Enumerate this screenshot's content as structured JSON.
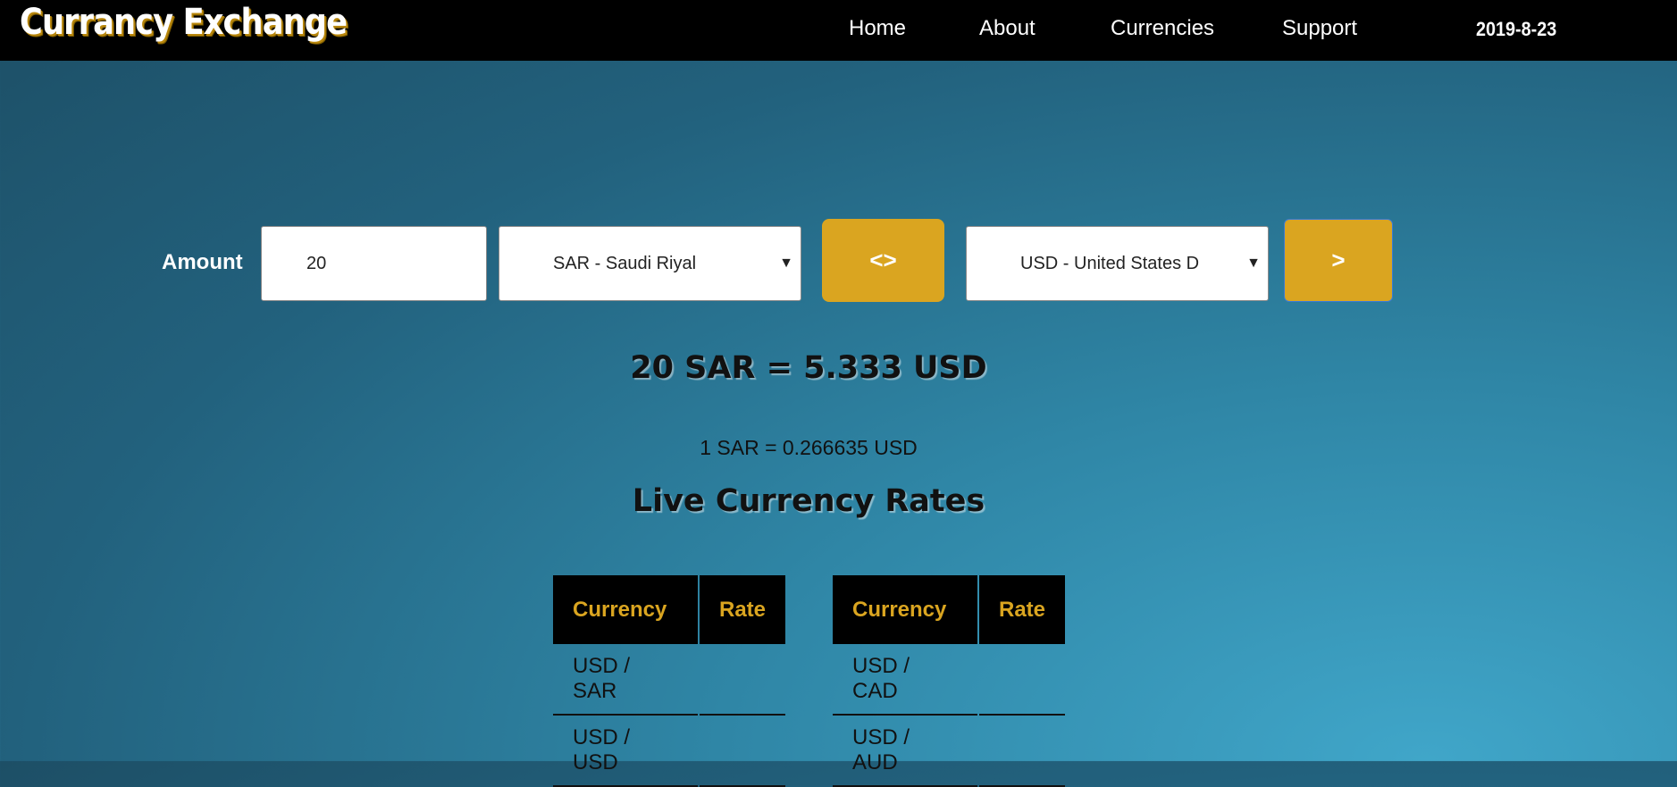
{
  "header": {
    "brand": "Currancy Exchange",
    "nav": [
      "Home",
      "About",
      "Currencies",
      "Support"
    ],
    "date": "2019-8-23"
  },
  "converter": {
    "amount_label": "Amount",
    "amount_value": "20",
    "from_currency": "SAR - Saudi Riyal",
    "swap_label": "<>",
    "to_currency": "USD - United States D",
    "convert_label": ">"
  },
  "result": {
    "main": "20 SAR = 5.333 USD",
    "unit_rate": "1 SAR = 0.266635 USD"
  },
  "rates": {
    "title": "Live Currency Rates",
    "headers": [
      "Currency",
      "Rate"
    ],
    "left_rows": [
      {
        "currency": "USD / SAR",
        "rate": ""
      },
      {
        "currency": "USD / USD",
        "rate": ""
      }
    ],
    "right_rows": [
      {
        "currency": "USD / CAD",
        "rate": ""
      },
      {
        "currency": "USD / AUD",
        "rate": ""
      }
    ]
  }
}
